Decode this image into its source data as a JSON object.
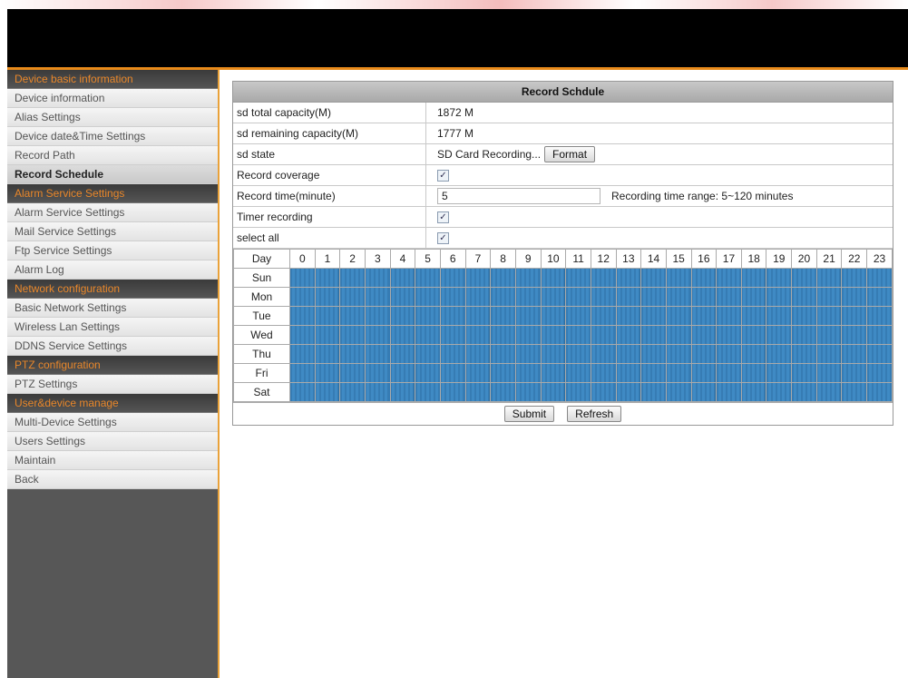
{
  "sidebar": {
    "groups": [
      {
        "header": "Device basic information",
        "items": [
          "Device information",
          "Alias Settings",
          "Device date&Time Settings",
          "Record Path",
          "Record Schedule"
        ]
      },
      {
        "header": "Alarm Service Settings",
        "items": [
          "Alarm Service Settings",
          "Mail Service Settings",
          "Ftp Service Settings",
          "Alarm Log"
        ]
      },
      {
        "header": "Network configuration",
        "items": [
          "Basic Network Settings",
          "Wireless Lan Settings",
          "DDNS Service Settings"
        ]
      },
      {
        "header": "PTZ configuration",
        "items": [
          "PTZ Settings"
        ]
      },
      {
        "header": "User&device manage",
        "items": [
          "Multi-Device Settings",
          "Users Settings",
          "Maintain",
          "Back"
        ]
      }
    ],
    "active_item": "Record Schedule"
  },
  "panel": {
    "title": "Record Schdule",
    "rows": {
      "total_label": "sd total capacity(M)",
      "total_value": "1872 M",
      "remaining_label": "sd remaining capacity(M)",
      "remaining_value": "1777 M",
      "state_label": "sd state",
      "state_value": "SD Card Recording...",
      "format_button": "Format",
      "coverage_label": "Record coverage",
      "time_label": "Record time(minute)",
      "time_value": "5",
      "time_hint": "Recording time range: 5~120 minutes",
      "timer_label": "Timer recording",
      "selectall_label": "select all"
    },
    "checkboxes": {
      "coverage": true,
      "timer": true,
      "selectall": true
    }
  },
  "schedule": {
    "corner": "Day",
    "hours": [
      "0",
      "1",
      "2",
      "3",
      "4",
      "5",
      "6",
      "7",
      "8",
      "9",
      "10",
      "11",
      "12",
      "13",
      "14",
      "15",
      "16",
      "17",
      "18",
      "19",
      "20",
      "21",
      "22",
      "23"
    ],
    "days": [
      "Sun",
      "Mon",
      "Tue",
      "Wed",
      "Thu",
      "Fri",
      "Sat"
    ],
    "all_selected": true
  },
  "buttons": {
    "submit": "Submit",
    "refresh": "Refresh"
  },
  "colors": {
    "accent": "#e88a1a",
    "schedule_fill": "#3f8ac4",
    "menu_header_text": "#e9872a"
  }
}
